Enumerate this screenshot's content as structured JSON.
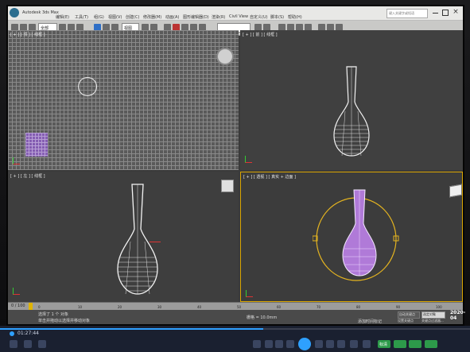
{
  "app": {
    "title": "Autodesk 3ds Max",
    "menu_items": [
      "编辑(E)",
      "工具(T)",
      "组(G)",
      "视图(V)",
      "创建(C)",
      "修改器(M)",
      "动画(A)",
      "图形编辑器(D)",
      "渲染(R)",
      "Civil View",
      "自定义(U)",
      "脚本(S)",
      "帮助(H)"
    ],
    "search_placeholder": "键入关键字或短语"
  },
  "toolbar": {
    "selection_filter": "全部",
    "view_dropdown": "视图"
  },
  "viewports": {
    "top": "[ + ] [ 顶 ] [ 线框 ]",
    "front": "[ + ] [ 前 ] [ 线框 ]",
    "left": "[ + ] [ 左 ] [ 线框 ]",
    "perspective": "[ + ] [ 透视 ] [ 真实 + 边面 ]"
  },
  "timeline": {
    "frame_indicator": "0 / 100",
    "ticks": [
      "0",
      "10",
      "20",
      "30",
      "40",
      "50",
      "60",
      "70",
      "80",
      "90",
      "100"
    ]
  },
  "status": {
    "selected": "选择了 1 个 对象",
    "hint": "单击并拖动以选择并移动对象",
    "auto_key": "自动关键点",
    "set_key": "设置关键点",
    "selected_obj": "选定对象",
    "key_filters": "关键点过滤器...",
    "add_time_tag": "添加时间标记",
    "grid": "栅格 = 10.0mm"
  },
  "overlay_date": "2020-04",
  "player": {
    "elapsed": "01:27:44",
    "progress": 0.56,
    "quality": "标清"
  }
}
